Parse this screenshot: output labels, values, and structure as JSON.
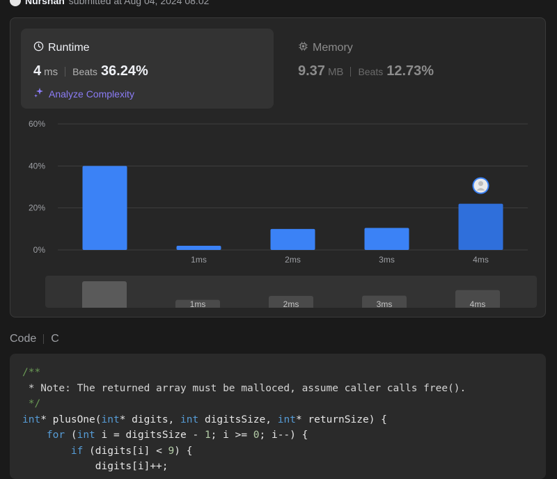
{
  "header": {
    "username": "Nurshan",
    "submitted_text": "submitted at Aug 04, 2024 08:02"
  },
  "runtime": {
    "title": "Runtime",
    "value": "4",
    "unit": "ms",
    "beats_label": "Beats",
    "beats_value": "36.24%",
    "analyze_label": "Analyze Complexity"
  },
  "memory": {
    "title": "Memory",
    "value": "9.37",
    "unit": "MB",
    "beats_label": "Beats",
    "beats_value": "12.73%"
  },
  "chart_data": {
    "type": "bar",
    "categories": [
      "",
      "1ms",
      "2ms",
      "3ms",
      "4ms"
    ],
    "values": [
      40,
      2,
      10,
      10.5,
      22
    ],
    "y_ticks": [
      "0%",
      "20%",
      "40%",
      "60%"
    ],
    "ylim": [
      0,
      60
    ],
    "highlight_category": "4ms",
    "grid": true,
    "colors": {
      "bar": "#3b82f6",
      "highlight_bar": "#2f6fdb",
      "grid": "#3f3f3f"
    }
  },
  "mini_chart": {
    "labels": [
      "",
      "1ms",
      "2ms",
      "3ms",
      "4ms"
    ],
    "values": [
      40,
      2,
      10,
      10.5,
      22
    ]
  },
  "code": {
    "label": "Code",
    "language": "C",
    "lines": [
      [
        [
          "cm",
          "/**"
        ]
      ],
      [
        [
          "cm-d",
          " * Note: The returned array must be malloced, assume caller calls free()."
        ]
      ],
      [
        [
          "cm",
          " */"
        ]
      ],
      [
        [
          "kw",
          "int"
        ],
        [
          "fn",
          "* plusOne("
        ],
        [
          "kw",
          "int"
        ],
        [
          "fn",
          "* digits, "
        ],
        [
          "kw",
          "int"
        ],
        [
          "fn",
          " digitsSize, "
        ],
        [
          "kw",
          "int"
        ],
        [
          "fn",
          "* returnSize) {"
        ]
      ],
      [
        [
          "fn",
          "    "
        ],
        [
          "kw",
          "for"
        ],
        [
          "fn",
          " ("
        ],
        [
          "kw",
          "int"
        ],
        [
          "fn",
          " i = digitsSize - "
        ],
        [
          "nm",
          "1"
        ],
        [
          "fn",
          "; i >= "
        ],
        [
          "nm",
          "0"
        ],
        [
          "fn",
          "; i--) {"
        ]
      ],
      [
        [
          "fn",
          "        "
        ],
        [
          "kw",
          "if"
        ],
        [
          "fn",
          " (digits[i] < "
        ],
        [
          "nm",
          "9"
        ],
        [
          "fn",
          ") {"
        ]
      ],
      [
        [
          "fn",
          "            digits[i]++;"
        ]
      ]
    ]
  }
}
